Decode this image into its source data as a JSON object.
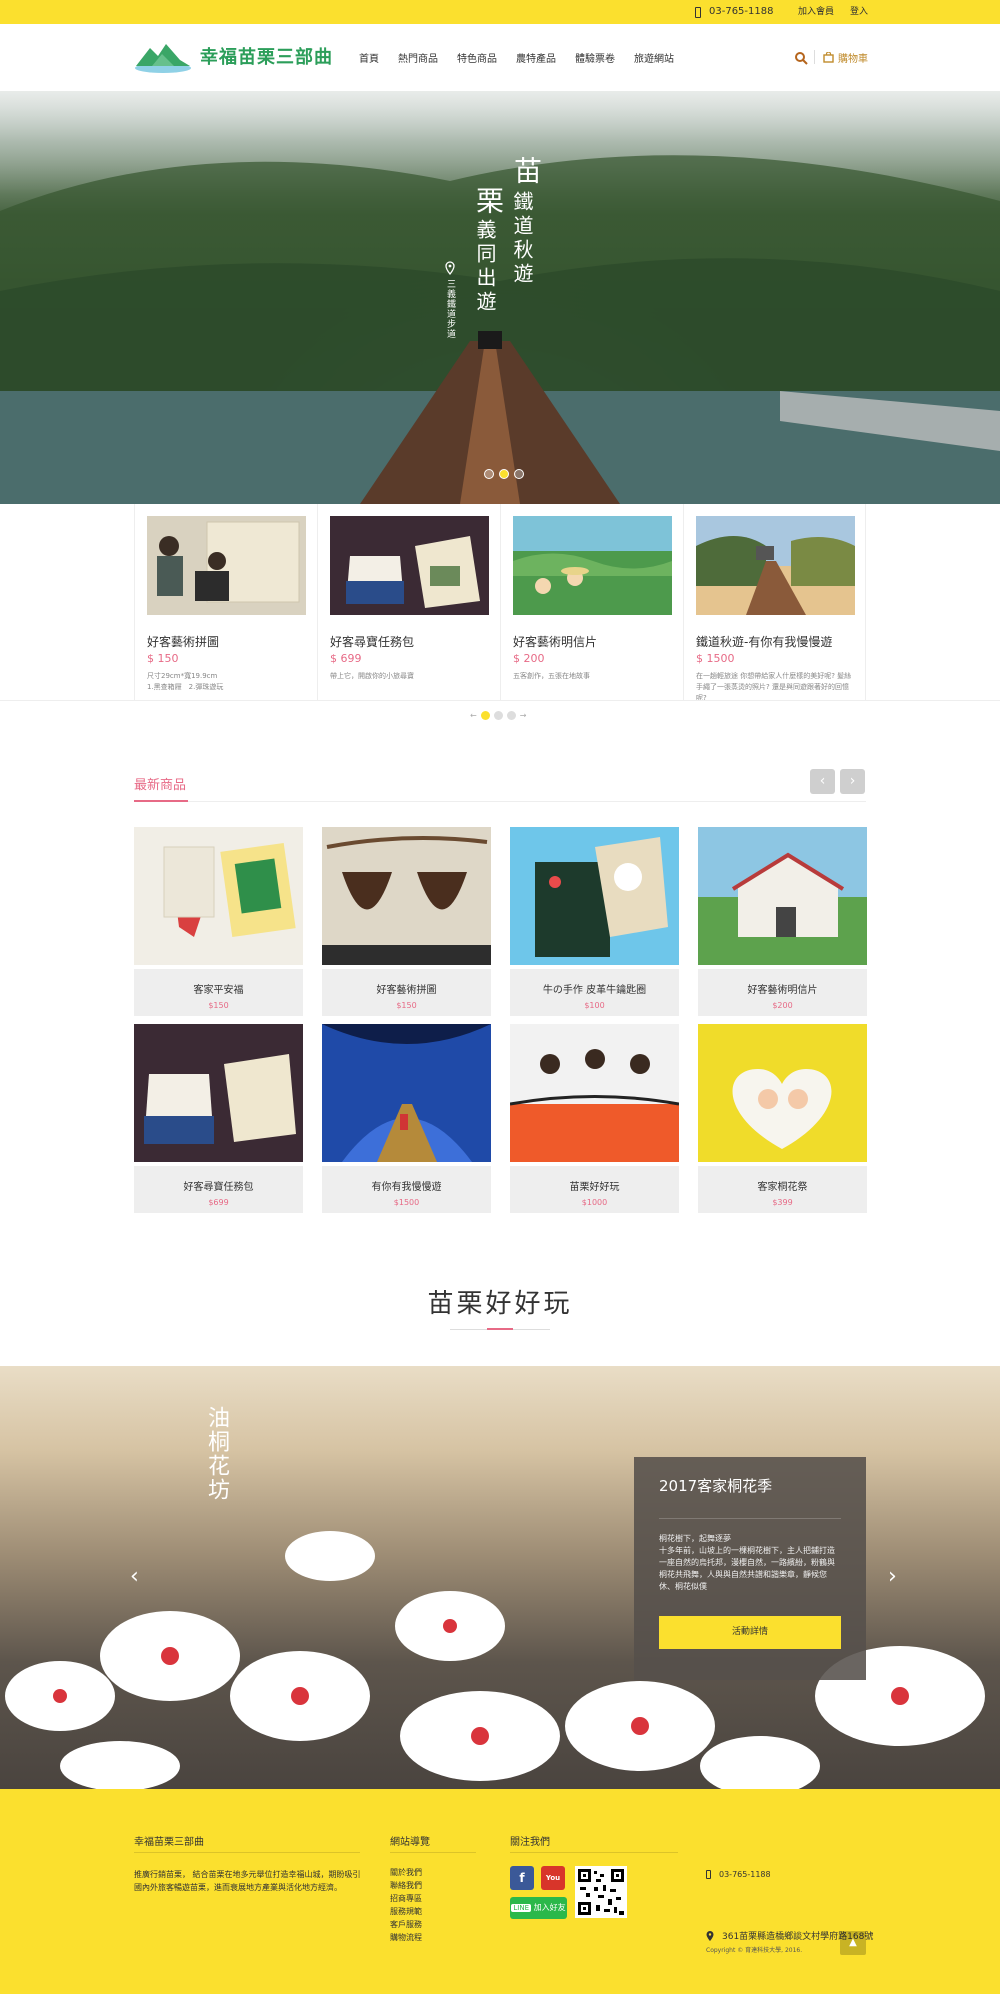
{
  "topbar": {
    "phone": "03-765-1188",
    "join": "加入會員",
    "login": "登入"
  },
  "header": {
    "logo_text": "幸福苗栗三部曲",
    "nav": [
      "首頁",
      "熱門商品",
      "特色商品",
      "農特產品",
      "體驗票卷",
      "旅遊網站"
    ],
    "cart_label": "購物車"
  },
  "hero": {
    "title_line1": "苗",
    "title_line2": "鐵道秋遊",
    "title_line3": "栗",
    "title_line4": "義同出遊",
    "location": "三義鐵道步道",
    "slides": 3,
    "active_slide": 2
  },
  "featured": [
    {
      "name": "好客藝術拼圖",
      "price": "$ 150",
      "desc": "尺寸29cm*寬19.9cm\n1.黑查箱屜　2.彈珠遊玩"
    },
    {
      "name": "好客尋寶任務包",
      "price": "$ 699",
      "desc": "帶上它，開啟你的小旅尋寶"
    },
    {
      "name": "好客藝術明信片",
      "price": "$ 200",
      "desc": "五客創作，五張在地故事"
    },
    {
      "name": "鐵道秋遊-有你有我慢慢遊",
      "price": "$ 1500",
      "desc": "在一趟輕旅途 你想帶給家人什麼樣的美好呢? 髮絲手繩了一張蒸烫的照片? 還是與同遊跟著好的回憶呢?"
    }
  ],
  "new_products": {
    "title": "最新商品",
    "items": [
      {
        "name": "客家平安福",
        "price": "$150"
      },
      {
        "name": "好客藝術拼圖",
        "price": "$150"
      },
      {
        "name": "牛の手作 皮革牛鑰匙圈",
        "price": "$100"
      },
      {
        "name": "好客藝術明信片",
        "price": "$200"
      },
      {
        "name": "好客尋寶任務包",
        "price": "$699"
      },
      {
        "name": "有你有我慢慢遊",
        "price": "$1500"
      },
      {
        "name": "苗栗好好玩",
        "price": "$1000"
      },
      {
        "name": "客家桐花祭",
        "price": "$399"
      }
    ]
  },
  "fun": {
    "title": "苗栗好好玩",
    "banner_logo": "油桐花坊",
    "event_title": "2017客家桐花季",
    "event_text": "桐花樹下，起舞逐夢\n十多年前，山坡上的一棵桐花樹下，主人把鋪打造一座自然的烏托邦，漫櫻自然，一路繽紛，粉鶴與桐花共飛舞，人與與自然共譜和諧樂章，靜候您休、桐花似僕",
    "event_button": "活動詳情"
  },
  "footer": {
    "about_title": "幸福苗栗三部曲",
    "about_text": "推廣行銷苗栗， 結合苗栗在地多元舉位打造幸福山城，期盼吸引國內外旅客暢遊苗栗，進而衰展地方產業與活化地方經濟。",
    "nav_title": "網站導覽",
    "links": [
      "關於我們",
      "聯絡我們",
      "招商專區",
      "服務規範",
      "客戶服務",
      "購物流程"
    ],
    "follow_title": "關注我們",
    "line_label": "加入好友",
    "phone": "03-765-1188",
    "address": "361苗栗縣造橋鄉談文村學府路168號",
    "copyright": "Copyright © 育達科技大學, 2016."
  },
  "colors": {
    "brand_yellow": "#fbe02e",
    "accent_pink": "#e76a86",
    "logo_green": "#2c9e5a"
  }
}
